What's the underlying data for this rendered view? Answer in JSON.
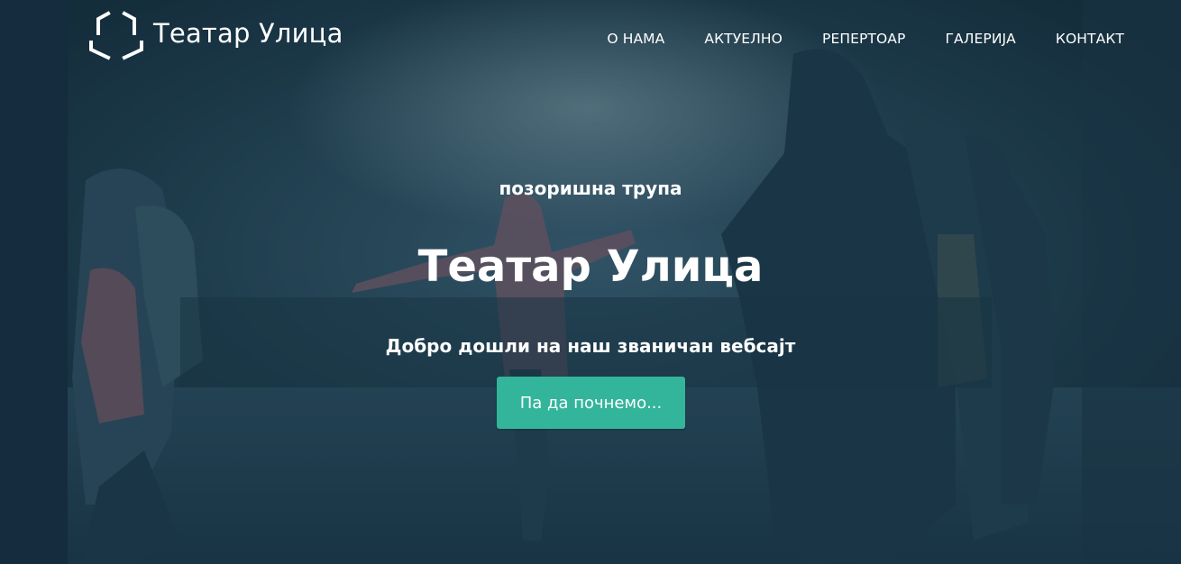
{
  "brand": {
    "name": "Театар Улица",
    "logo_icon": "hexagon-outline-icon"
  },
  "nav": {
    "items": [
      {
        "label": "О НАМА"
      },
      {
        "label": "АКТУЕЛНО"
      },
      {
        "label": "РЕПЕРТОАР"
      },
      {
        "label": "ГАЛЕРИЈА"
      },
      {
        "label": "КОНТАКТ"
      }
    ]
  },
  "hero": {
    "subtitle": "позоришна трупа",
    "title": "Театар Улица",
    "welcome": "Добро дошли на наш званичан вебсајт",
    "cta_label": "Па да почнемо..."
  },
  "colors": {
    "accent": "#33b59b",
    "overlay": "#163446",
    "text": "#ffffff"
  }
}
